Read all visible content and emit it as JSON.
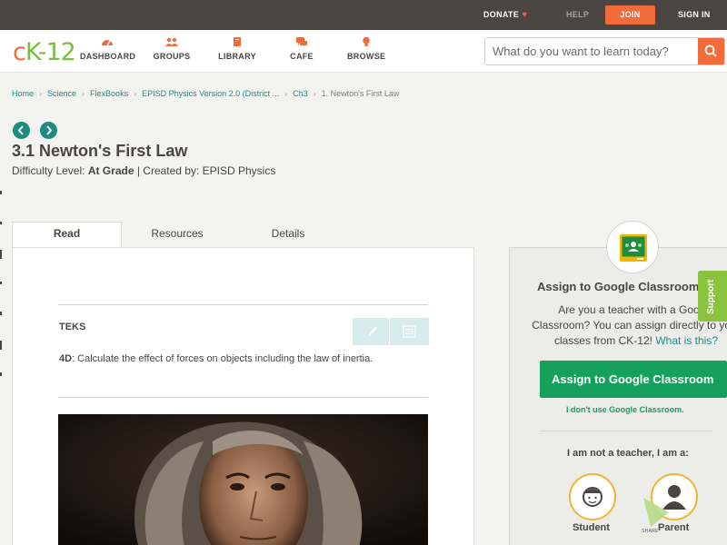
{
  "topbar": {
    "donate": "DONATE",
    "help": "HELP",
    "join": "JOIN",
    "signin": "SIGN IN"
  },
  "brand": {
    "logo_c": "c",
    "logo_k": "K",
    "logo_rest": "-12"
  },
  "nav": {
    "dashboard": "DASHBOARD",
    "groups": "GROUPS",
    "library": "LIBRARY",
    "cafe": "CAFE",
    "browse": "BROWSE"
  },
  "search": {
    "placeholder": "What do you want to learn today?"
  },
  "breadcrumb": [
    "Home",
    "Science",
    "FlexBooks",
    "EPISD Physics Version 2.0 (District ...",
    "Ch3",
    "1. Newton's First Law"
  ],
  "page": {
    "title": "3.1 Newton's First Law",
    "difficulty_prefix": "Difficulty Level: ",
    "difficulty_value": "At Grade",
    "created_by": " | Created by: EPISD Physics"
  },
  "tabs": {
    "read": "Read",
    "resources": "Resources",
    "details": "Details"
  },
  "content": {
    "teks_label": "TEKS",
    "teks_code": "4D",
    "teks_text": ":  Calculate the effect of forces on objects including the law of inertia."
  },
  "assign": {
    "title": "Assign to Google Classroom",
    "desc_1": "Are you a teacher with a Google",
    "desc_2": "Classroom? You can assign directly to your",
    "desc_3": "classes from CK-12! ",
    "what_is_this": "What is this?",
    "button": "Assign to Google Classroom",
    "dont_use": "I don't use Google Classroom.",
    "not_teacher": "I am not a teacher, I am a:",
    "student": "Student",
    "parent": "Parent",
    "share": "SHARE"
  },
  "support": "Support",
  "colors": {
    "accent_orange": "#f26b3a",
    "teal": "#1b8c8c",
    "green": "#16a05d",
    "support_green": "#8ac43f",
    "topbar": "#4a4543"
  }
}
